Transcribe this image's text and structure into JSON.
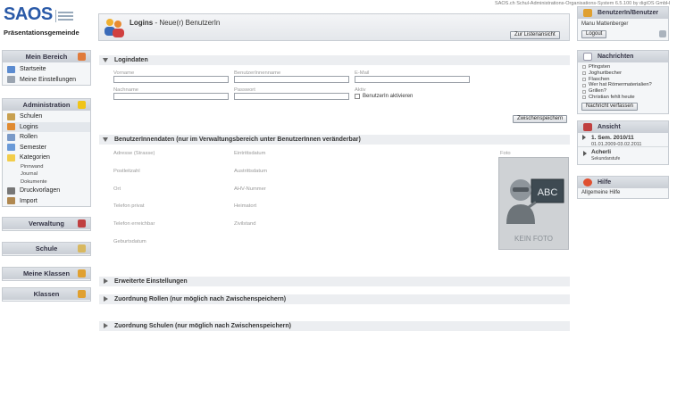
{
  "top_info": "SAOS.ch Schul-Administrations-Organisations-System 6.5.100 by digiOS GmbH",
  "logo": {
    "name": "SAOS",
    "school": "Präsentationsgemeinde"
  },
  "left": {
    "mein_bereich": {
      "title": "Mein Bereich",
      "items": [
        "Startseite",
        "Meine Einstellungen"
      ]
    },
    "administration": {
      "title": "Administration",
      "items": [
        "Schulen",
        "Logins",
        "Rollen",
        "Semester",
        "Kategorien"
      ],
      "subitems": [
        "Pinnwand",
        "Journal",
        "Dokumente"
      ],
      "items2": [
        "Druckvorlagen",
        "Import"
      ]
    },
    "verwaltung": "Verwaltung",
    "schule": "Schule",
    "meine_klassen": "Meine Klassen",
    "klassen": "Klassen"
  },
  "main": {
    "title": "Logins",
    "subtitle": " - Neue(r) BenutzerIn",
    "back_button": "Zur Listenansicht",
    "logindaten": {
      "title": "Logindaten",
      "fields": {
        "vorname": "Vorname",
        "benutzername": "BenutzerInnenname",
        "email": "E-Mail",
        "nachname": "Nachname",
        "passwort": "Passwort",
        "aktiv": "Aktiv",
        "aktivieren": "BenutzerIn aktivieren"
      },
      "save_button": "Zwischenspeichern"
    },
    "benutzerdaten": {
      "title": "BenutzerInnendaten (nur im Verwaltungsbereich unter BenutzerInnen veränderbar)",
      "col1": [
        "Adresse (Strasse)",
        "Postleitzahl",
        "Ort",
        "Telefon privat",
        "Telefon erreichbar",
        "Geburtsdatum"
      ],
      "col2": [
        "Eintrittsdatum",
        "Austrittsdatum",
        "AHV-Nummer",
        "Heimatort",
        "Zivilstand"
      ],
      "foto_label": "Foto",
      "kein_foto": "KEIN FOTO",
      "board_text": "ABC"
    },
    "erweiterte": "Erweiterte Einstellungen",
    "rollen": "Zuordnung Rollen (nur möglich nach Zwischenspeichern)",
    "schulen": "Zuordnung Schulen (nur möglich nach Zwischenspeichern)"
  },
  "right": {
    "benutzer": {
      "title": "BenutzerIn/Benutzer",
      "name": "Manu Mattenberger",
      "logout": "Logout"
    },
    "nachrichten": {
      "title": "Nachrichten",
      "items": [
        "Pfingsten",
        "Joghurtbecher",
        "Flaschen",
        "Wer hat Römermaterialien?",
        "Grillen?",
        "Christian fehlt heute"
      ],
      "button": "Nachricht verfassen"
    },
    "ansicht": {
      "title": "Ansicht",
      "semester": "1. Sem. 2010/11",
      "semester_dates": "01.01.2009-03.02.2011",
      "schule": "Acherli",
      "stufe": "Sekundarstufe"
    },
    "hilfe": {
      "title": "Hilfe",
      "text": "Allgemeine Hilfe"
    }
  },
  "colors": {
    "brand": "#2a5aa8",
    "panel_header": "#d4d8de",
    "section_bg": "#eceef1"
  }
}
